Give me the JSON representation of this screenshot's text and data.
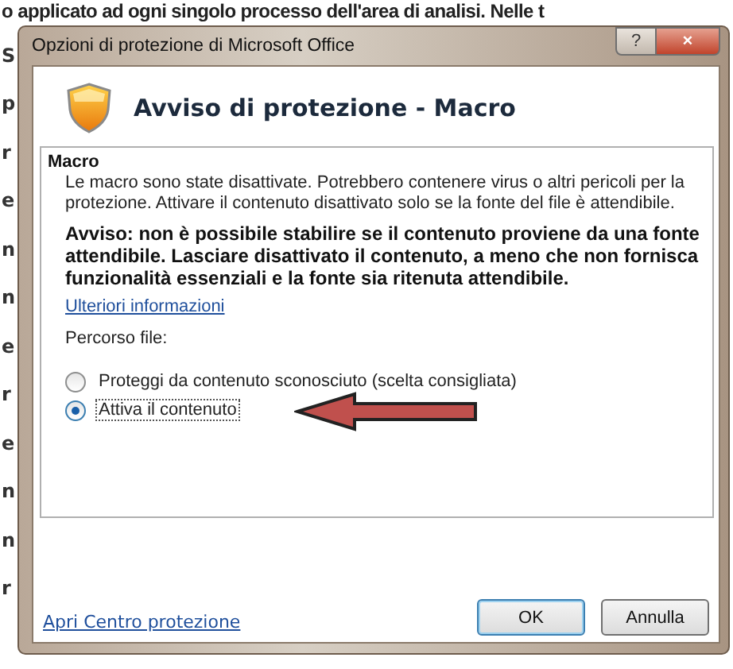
{
  "background_document": {
    "top_line": "o applicato ad ogni singolo processo dell'area di analisi. Nelle t",
    "margin_fragments": [
      "S",
      "p",
      "r",
      "e",
      "n",
      "n",
      "e",
      "r",
      "e",
      "n",
      "n",
      "r"
    ]
  },
  "window": {
    "title": "Opzioni di protezione di Microsoft Office",
    "help_button": "?",
    "close_button": "×"
  },
  "header": {
    "title": "Avviso di protezione - Macro"
  },
  "section": {
    "heading": "Macro",
    "description": "Le macro sono state disattivate. Potrebbero contenere virus o altri pericoli per la protezione. Attivare il contenuto disattivato solo se la fonte del file è attendibile.",
    "warning": "Avviso: non è possibile stabilire se il contenuto proviene da una fonte attendibile. Lasciare disattivato il contenuto, a meno che non fornisca funzionalità essenziali e la fonte sia ritenuta attendibile.",
    "link": "Ulteriori informazioni",
    "path_label": "Percorso file:",
    "options": [
      {
        "label": "Proteggi da contenuto sconosciuto (scelta consigliata)",
        "selected": false
      },
      {
        "label": "Attiva il contenuto",
        "selected": true
      }
    ]
  },
  "footer": {
    "link": "Apri Centro protezione",
    "buttons": [
      {
        "label": "OK",
        "kind": "default"
      },
      {
        "label": "Annulla",
        "kind": "normal"
      }
    ]
  }
}
